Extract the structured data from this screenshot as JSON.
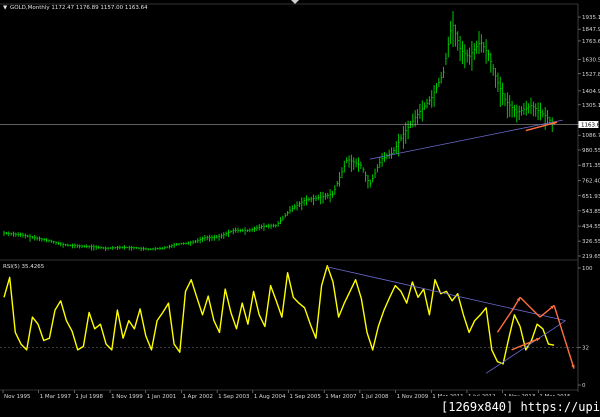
{
  "chart_data": [
    {
      "type": "bar",
      "title": "GOLD,Monthly 1172.47 1176.89 1157.00 1163.64",
      "ylim": [
        219.65,
        2000
      ],
      "yticks": [
        "1935.15",
        "1847.90",
        "1763.65",
        "1630.55",
        "1527.85",
        "1404.95",
        "1305.15",
        "1163.64",
        "1086.75",
        "980.55",
        "871.35",
        "762.40",
        "651.93",
        "543.85",
        "434.55",
        "326.55",
        "219.65"
      ],
      "current_price": 1163.64,
      "x_tick_labels": [
        "Nov 1995",
        "1 Mar 1997",
        "1 Jul 1998",
        "1 Nov 1999",
        "1 Jan 2001",
        "1 Apr 2002",
        "1 Sep 2003",
        "1 Aug 2004",
        "1 Sep 2005",
        "1 Mar 2007",
        "1 Jul 2008",
        "1 Nov 2009",
        "1 Mar 2011",
        "1 Jul 2012",
        "1 Nov 2013",
        "1 Mar 2015"
      ],
      "series": [
        {
          "x": [
            1995.9,
            1996.5,
            1997.0,
            1997.5,
            1998.0,
            1998.5,
            1999.0,
            1999.5,
            2000.0,
            2000.5,
            2001.0,
            2001.5,
            2002.0,
            2002.5,
            2003.0,
            2003.5,
            2004.0,
            2004.5,
            2005.0,
            2005.5,
            2006.0,
            2006.5,
            2007.0,
            2007.5,
            2008.0,
            2008.5,
            2008.8,
            2009.2,
            2009.6,
            2010.0,
            2010.5,
            2011.0,
            2011.4,
            2011.7,
            2012.0,
            2012.3,
            2012.7,
            2013.0,
            2013.3,
            2013.6,
            2014.0,
            2014.5,
            2015.0,
            2015.3
          ],
          "values": [
            385,
            372,
            350,
            330,
            300,
            292,
            287,
            275,
            283,
            279,
            268,
            275,
            305,
            315,
            352,
            358,
            405,
            402,
            432,
            438,
            552,
            620,
            640,
            665,
            915,
            870,
            730,
            915,
            960,
            1100,
            1240,
            1360,
            1540,
            1895,
            1700,
            1650,
            1760,
            1660,
            1470,
            1330,
            1250,
            1300,
            1225,
            1164
          ]
        }
      ],
      "trendlines": [
        {
          "x": [
            2008.8,
            2015.6
          ],
          "values": [
            915,
            1195
          ],
          "color": "#6a6ad0"
        }
      ],
      "arrows": [
        {
          "x": [
            2014.3,
            2015.4
          ],
          "values": [
            1120,
            1180
          ],
          "color": "#ff7040"
        }
      ],
      "colors": {
        "bars": "#00dc00",
        "price_line": "#c0c0c0",
        "grid": "#646464"
      }
    },
    {
      "type": "line",
      "title": "RSI(5) 35.4265",
      "ylim": [
        0,
        100
      ],
      "yticks": [
        "100",
        "32",
        "0"
      ],
      "level": 32,
      "series": [
        {
          "x": [
            1995.9,
            1996.1,
            1996.3,
            1996.5,
            1996.7,
            1996.9,
            1997.1,
            1997.3,
            1997.5,
            1997.7,
            1997.9,
            1998.1,
            1998.3,
            1998.5,
            1998.7,
            1998.9,
            1999.1,
            1999.3,
            1999.5,
            1999.7,
            1999.9,
            2000.1,
            2000.3,
            2000.5,
            2000.7,
            2000.9,
            2001.1,
            2001.3,
            2001.5,
            2001.7,
            2001.9,
            2002.1,
            2002.3,
            2002.5,
            2002.7,
            2002.9,
            2003.1,
            2003.3,
            2003.5,
            2003.7,
            2003.9,
            2004.1,
            2004.3,
            2004.5,
            2004.7,
            2004.9,
            2005.1,
            2005.3,
            2005.5,
            2005.7,
            2005.9,
            2006.1,
            2006.3,
            2006.5,
            2006.7,
            2006.9,
            2007.1,
            2007.3,
            2007.5,
            2007.7,
            2007.9,
            2008.1,
            2008.3,
            2008.5,
            2008.7,
            2008.9,
            2009.1,
            2009.3,
            2009.5,
            2009.7,
            2009.9,
            2010.1,
            2010.3,
            2010.5,
            2010.7,
            2010.9,
            2011.1,
            2011.3,
            2011.5,
            2011.7,
            2011.9,
            2012.1,
            2012.3,
            2012.5,
            2012.7,
            2012.9,
            2013.1,
            2013.3,
            2013.5,
            2013.7,
            2013.9,
            2014.1,
            2014.3,
            2014.5,
            2014.7,
            2014.9,
            2015.1,
            2015.3
          ],
          "values": [
            75,
            92,
            45,
            35,
            30,
            58,
            52,
            38,
            40,
            64,
            72,
            55,
            46,
            30,
            33,
            62,
            48,
            52,
            35,
            30,
            64,
            40,
            55,
            48,
            65,
            42,
            30,
            55,
            62,
            70,
            35,
            28,
            80,
            90,
            75,
            60,
            76,
            55,
            45,
            82,
            62,
            48,
            70,
            52,
            80,
            60,
            50,
            85,
            72,
            58,
            96,
            75,
            70,
            66,
            52,
            40,
            85,
            102,
            88,
            58,
            70,
            80,
            90,
            74,
            45,
            30,
            50,
            64,
            75,
            85,
            80,
            70,
            88,
            75,
            82,
            60,
            90,
            78,
            80,
            72,
            78,
            60,
            45,
            55,
            60,
            66,
            30,
            20,
            18,
            40,
            60,
            50,
            30,
            38,
            52,
            48,
            35,
            34
          ]
        }
      ],
      "trendlines": [
        {
          "x": [
            2007.3,
            2015.7
          ],
          "values": [
            101,
            55
          ],
          "color": "#6a6ad0"
        },
        {
          "x": [
            2012.9,
            2015.7
          ],
          "values": [
            10,
            55
          ],
          "color": "#6a6ad0"
        }
      ],
      "arrows": [
        {
          "x": [
            2013.3,
            2013.8
          ],
          "values": [
            45,
            63
          ],
          "color": "#ff7040"
        },
        {
          "x": [
            2013.8,
            2014.1
          ],
          "values": [
            63,
            75
          ],
          "color": "#ff7040"
        },
        {
          "x": [
            2014.1,
            2014.8
          ],
          "values": [
            75,
            58
          ],
          "color": "#ff7040"
        },
        {
          "x": [
            2014.8,
            2015.3
          ],
          "values": [
            58,
            68
          ],
          "color": "#ff7040"
        },
        {
          "x": [
            2015.3,
            2016.0
          ],
          "values": [
            68,
            14
          ],
          "color": "#ff7040"
        },
        {
          "x": [
            2013.8,
            2014.8
          ],
          "values": [
            30,
            40
          ],
          "color": "#ff7040"
        }
      ],
      "colors": {
        "line": "#ffff00",
        "grid": "#646464"
      }
    }
  ],
  "watermark": "[1269x840] https://upic.me/",
  "dropdown_glyph": "▼"
}
